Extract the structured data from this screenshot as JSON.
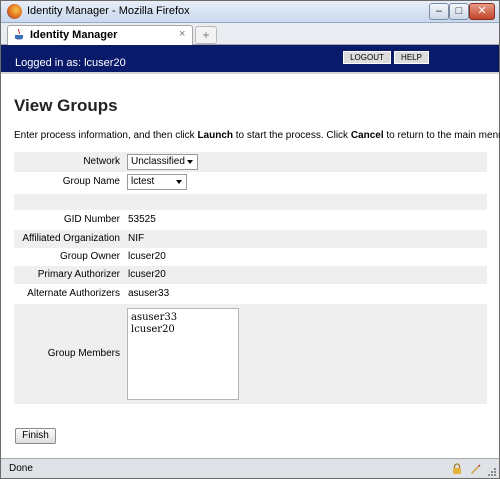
{
  "window": {
    "title": "Identity Manager - Mozilla Firefox",
    "controls": {
      "minimize": "–",
      "maximize": "□",
      "close": "✕"
    }
  },
  "tab": {
    "label": "Identity Manager",
    "close": "×",
    "new_tab": "+"
  },
  "header": {
    "logged_in": "Logged in as: lcuser20",
    "logout_label": "LOGOUT",
    "help_label": "HELP",
    "bg_color": "#0a1a6b"
  },
  "page": {
    "title": "View Groups",
    "instructions": {
      "pre": "Enter process information, and then click ",
      "launch": "Launch",
      "mid": " to start the process. Click ",
      "cancel": "Cancel",
      "post": " to return to the main menu."
    }
  },
  "form": {
    "network": {
      "label": "Network",
      "value": "Unclassified"
    },
    "group_name": {
      "label": "Group Name",
      "value": "lctest"
    },
    "gid_number": {
      "label": "GID Number",
      "value": "53525"
    },
    "affiliated_org": {
      "label": "Affiliated Organization",
      "value": "NIF"
    },
    "group_owner": {
      "label": "Group Owner",
      "value": "lcuser20"
    },
    "primary_authorizer": {
      "label": "Primary Authorizer",
      "value": "lcuser20"
    },
    "alternate_authorizers": {
      "label": "Alternate Authorizers",
      "value": "asuser33"
    },
    "group_members": {
      "label": "Group Members",
      "members": [
        "asuser33",
        "lcuser20"
      ]
    }
  },
  "buttons": {
    "finish": "Finish"
  },
  "status": {
    "text": "Done"
  }
}
